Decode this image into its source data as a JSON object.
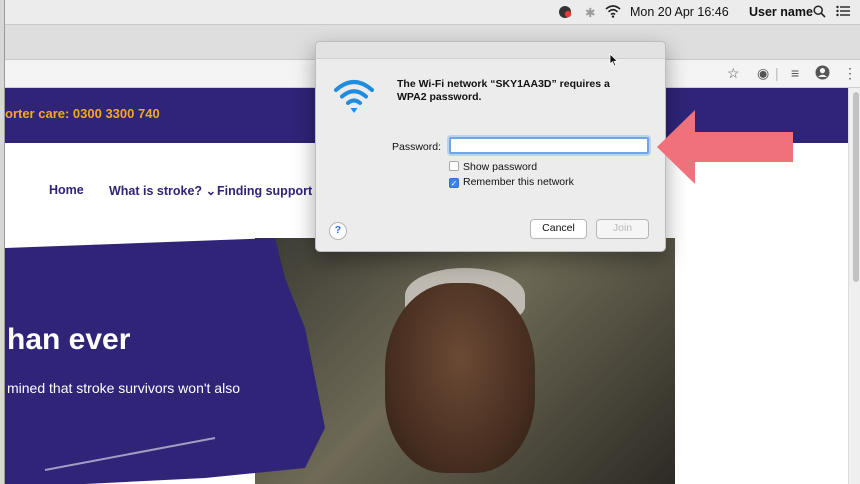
{
  "menubar": {
    "datetime": "Mon 20 Apr 16:46",
    "user": "User name"
  },
  "site": {
    "care_line": "orter care: 0300 3300 740",
    "nav": [
      "Home",
      "What is stroke?",
      "Finding support"
    ],
    "hero_title": "han ever",
    "hero_subtitle": "mined that stroke survivors won't also"
  },
  "dialog": {
    "message": "The Wi-Fi network “SKY1AA3D” requires a WPA2 password.",
    "password_label": "Password:",
    "password_value": "",
    "show_password": "Show password",
    "remember_network": "Remember this network",
    "show_password_checked": false,
    "remember_checked": true,
    "help": "?",
    "cancel": "Cancel",
    "join": "Join"
  },
  "colors": {
    "brand_purple": "#2f2478",
    "care_orange": "#f5a623",
    "arrow_pink": "#f0707c",
    "wifi_blue": "#1f8ce0"
  }
}
